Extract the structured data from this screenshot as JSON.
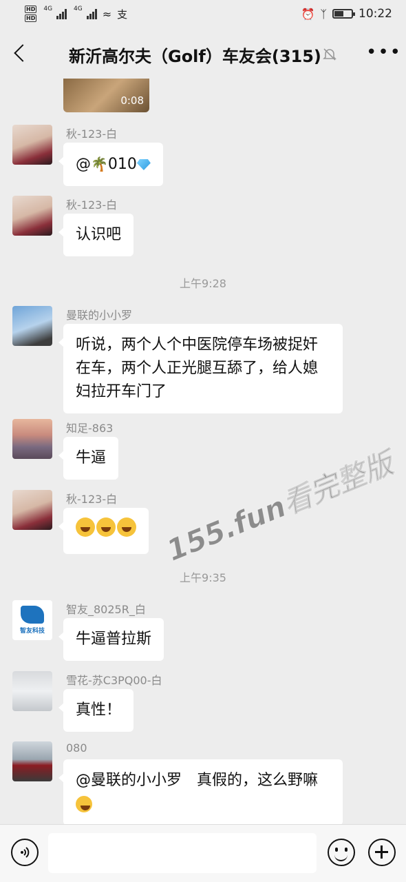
{
  "status_bar": {
    "network_left": "HD",
    "network_tag_1": "4G",
    "network_tag_2": "4G",
    "time": "10:22"
  },
  "header": {
    "title": "新沂高尔夫（Golf）车友会(315)",
    "back_icon": "back-chevron-icon",
    "mute_icon": "bell-muted-icon",
    "more_icon": "more-dots-icon"
  },
  "video": {
    "duration": "0:08"
  },
  "messages": [
    {
      "sender": "秋-123-白",
      "text_prefix": "@",
      "text_suffix": "010",
      "avatar": "girl-photo"
    },
    {
      "sender": "秋-123-白",
      "text": "认识吧",
      "avatar": "girl-photo"
    },
    {
      "sender": "曼联的小小罗",
      "text": "听说，两个人个中医院停车场被捉奸在车，两个人正光腿互舔了，给人媳妇拉开车门了",
      "avatar": "soccer-player-photo"
    },
    {
      "sender": "知足-863",
      "text": "牛逼",
      "avatar": "sunset-couple-photo"
    },
    {
      "sender": "秋-123-白",
      "emoji": "laughing-tears",
      "avatar": "girl-photo"
    },
    {
      "sender": "智友_8025R_白",
      "text": "牛逼普拉斯",
      "avatar": "company-logo",
      "avatar_text": "智友科技"
    },
    {
      "sender": "雪花-苏C3PQ00-白",
      "text": "真性！",
      "avatar": "snow-landscape-photo"
    },
    {
      "sender": "080",
      "text": "@曼联的小小罗　真假的，这么野嘛",
      "avatar": "red-car-photo"
    }
  ],
  "timestamps": [
    "上午9:28",
    "上午9:35"
  ],
  "watermark": "155.fun看完整版",
  "input_bar": {
    "voice_icon": "voice-icon",
    "emoji_icon": "emoji-icon",
    "plus_icon": "plus-icon"
  }
}
